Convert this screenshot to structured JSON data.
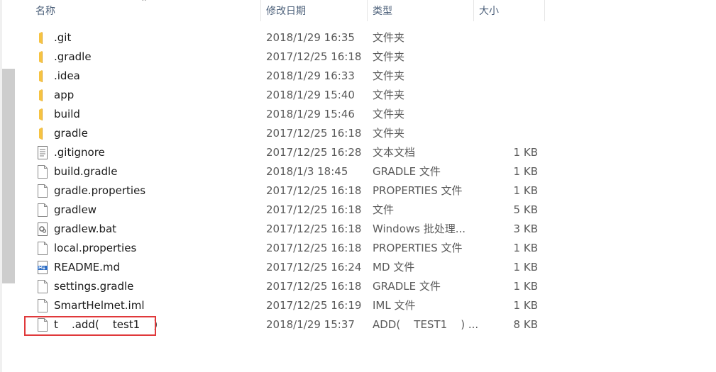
{
  "header": {
    "name": "名称",
    "date_modified": "修改日期",
    "type": "类型",
    "size": "大小"
  },
  "colors": {
    "folder": "#f6c342",
    "highlight": "#e0393b",
    "header_text": "#4c607a"
  },
  "files": [
    {
      "name": ".git",
      "date": "2018/1/29 16:35",
      "type": "文件夹",
      "size": "",
      "icon": "folder-icon"
    },
    {
      "name": ".gradle",
      "date": "2017/12/25 16:18",
      "type": "文件夹",
      "size": "",
      "icon": "folder-icon"
    },
    {
      "name": ".idea",
      "date": "2018/1/29 16:33",
      "type": "文件夹",
      "size": "",
      "icon": "folder-icon"
    },
    {
      "name": "app",
      "date": "2018/1/29 15:40",
      "type": "文件夹",
      "size": "",
      "icon": "folder-icon"
    },
    {
      "name": "build",
      "date": "2018/1/29 15:46",
      "type": "文件夹",
      "size": "",
      "icon": "folder-icon"
    },
    {
      "name": "gradle",
      "date": "2017/12/25 16:18",
      "type": "文件夹",
      "size": "",
      "icon": "folder-icon"
    },
    {
      "name": ".gitignore",
      "date": "2017/12/25 16:28",
      "type": "文本文档",
      "size": "1 KB",
      "icon": "text-document-icon"
    },
    {
      "name": "build.gradle",
      "date": "2018/1/3 18:45",
      "type": "GRADLE 文件",
      "size": "1 KB",
      "icon": "file-icon"
    },
    {
      "name": "gradle.properties",
      "date": "2017/12/25 16:18",
      "type": "PROPERTIES 文件",
      "size": "1 KB",
      "icon": "file-icon"
    },
    {
      "name": "gradlew",
      "date": "2017/12/25 16:18",
      "type": "文件",
      "size": "5 KB",
      "icon": "file-icon"
    },
    {
      "name": "gradlew.bat",
      "date": "2017/12/25 16:18",
      "type": "Windows 批处理...",
      "size": "3 KB",
      "icon": "batch-file-icon"
    },
    {
      "name": "local.properties",
      "date": "2017/12/25 16:18",
      "type": "PROPERTIES 文件",
      "size": "1 KB",
      "icon": "file-icon"
    },
    {
      "name": "README.md",
      "date": "2017/12/25 16:24",
      "type": "MD 文件",
      "size": "1 KB",
      "icon": "markdown-file-icon"
    },
    {
      "name": "settings.gradle",
      "date": "2017/12/25 16:18",
      "type": "GRADLE 文件",
      "size": "1 KB",
      "icon": "file-icon"
    },
    {
      "name": "SmartHelmet.iml",
      "date": "2017/12/25 16:19",
      "type": "IML 文件",
      "size": "1 KB",
      "icon": "file-icon"
    },
    {
      "name": "t    .add(    test1    )",
      "date": "2018/1/29 15:37",
      "type": "ADD(    TEST1    ) ...",
      "size": "8 KB",
      "icon": "file-icon"
    }
  ]
}
